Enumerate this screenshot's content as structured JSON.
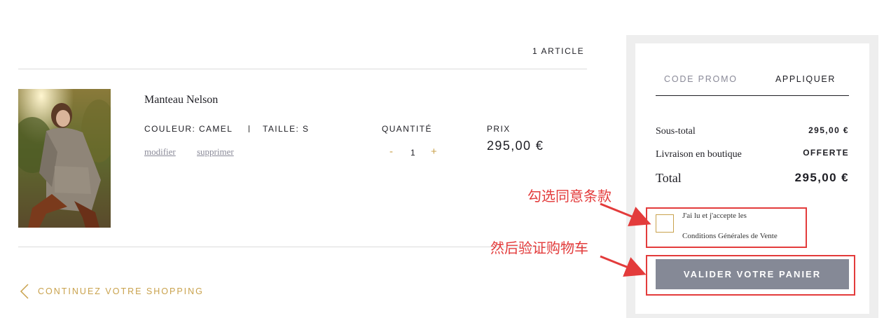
{
  "cart": {
    "article_count": "1 ARTICLE",
    "item": {
      "name": "Manteau Nelson",
      "color": "COULEUR: CAMEL",
      "size": "TAILLE: S",
      "modify": "modifier",
      "remove": "supprimer",
      "qty_label": "QUANTITÉ",
      "qty_minus": "-",
      "qty_value": "1",
      "qty_plus": "+",
      "price_label": "PRIX",
      "price": "295,00 €"
    },
    "continue_shopping": "CONTINUEZ VOTRE SHOPPING"
  },
  "summary": {
    "promo_label": "CODE PROMO",
    "promo_apply": "APPLIQUER",
    "subtotal_label": "Sous-total",
    "subtotal_value": "295,00 €",
    "delivery_label": "Livraison en boutique",
    "delivery_value": "OFFERTE",
    "total_label": "Total",
    "total_value": "295,00 €",
    "terms_line1": "J'ai lu et j'accepte les",
    "terms_line2": "Conditions Générales de Vente",
    "checkbox_checked": false,
    "cta": "VALIDER VOTRE PANIER"
  },
  "annotations": {
    "check_terms": "勾选同意条款",
    "validate_cart": "然后验证购物车"
  },
  "colors": {
    "accent_gold": "#c9a24d",
    "cta_gray": "#858996",
    "annotation_red": "#e33b3b"
  }
}
